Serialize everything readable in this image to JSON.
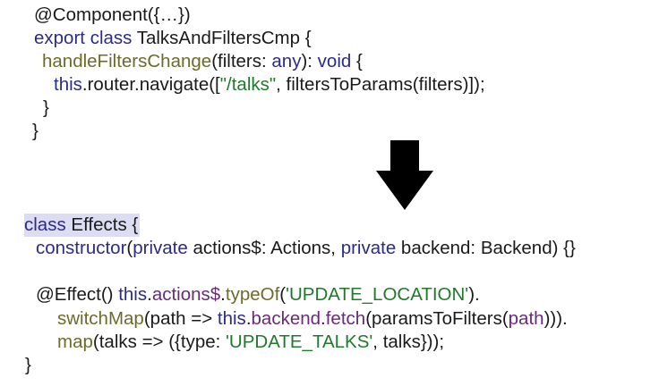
{
  "top_code": [
    [
      {
        "t": "@Component({…})",
        "c": "c-plain"
      }
    ],
    [
      {
        "t": "export",
        "c": "c-kw"
      },
      {
        "t": " ",
        "c": "c-plain"
      },
      {
        "t": "class",
        "c": "c-kw"
      },
      {
        "t": " TalksAndFiltersCmp {",
        "c": "c-plain"
      }
    ],
    [
      {
        "t": "handleFiltersChange",
        "c": "c-fn"
      },
      {
        "t": "(filters: ",
        "c": "c-plain"
      },
      {
        "t": "any",
        "c": "c-kw"
      },
      {
        "t": "): ",
        "c": "c-plain"
      },
      {
        "t": "void",
        "c": "c-kw"
      },
      {
        "t": " {",
        "c": "c-plain"
      }
    ],
    [
      {
        "t": "this",
        "c": "c-kw"
      },
      {
        "t": ".router.navigate([",
        "c": "c-plain"
      },
      {
        "t": "\"/talks\"",
        "c": "c-str"
      },
      {
        "t": ", filtersToParams(filters)]);",
        "c": "c-plain"
      }
    ],
    [
      {
        "t": "}",
        "c": "c-plain"
      }
    ],
    [
      {
        "t": "}",
        "c": "c-plain"
      }
    ]
  ],
  "bottom_code": [
    [
      {
        "t": "class",
        "c": "c-kw"
      },
      {
        "t": " Effects {",
        "c": "c-plain"
      }
    ],
    [
      {
        "t": "constructor",
        "c": "c-kw"
      },
      {
        "t": "(",
        "c": "c-plain"
      },
      {
        "t": "private",
        "c": "c-kw"
      },
      {
        "t": " actions$: Actions, ",
        "c": "c-plain"
      },
      {
        "t": "private",
        "c": "c-kw"
      },
      {
        "t": " backend: Backend) {}",
        "c": "c-plain"
      }
    ],
    [
      {
        "t": "",
        "c": "c-plain"
      }
    ],
    [
      {
        "t": "@Effect() ",
        "c": "c-plain"
      },
      {
        "t": "this",
        "c": "c-kw"
      },
      {
        "t": ".",
        "c": "c-plain"
      },
      {
        "t": "actions$",
        "c": "c-prop"
      },
      {
        "t": ".",
        "c": "c-plain"
      },
      {
        "t": "typeOf",
        "c": "c-fn"
      },
      {
        "t": "(",
        "c": "c-plain"
      },
      {
        "t": "'UPDATE_LOCATION'",
        "c": "c-str"
      },
      {
        "t": ").",
        "c": "c-plain"
      }
    ],
    [
      {
        "t": "switchMap",
        "c": "c-fn"
      },
      {
        "t": "(path => ",
        "c": "c-plain"
      },
      {
        "t": "this",
        "c": "c-kw"
      },
      {
        "t": ".",
        "c": "c-plain"
      },
      {
        "t": "backend",
        "c": "c-prop"
      },
      {
        "t": ".",
        "c": "c-plain"
      },
      {
        "t": "fetch",
        "c": "c-prop"
      },
      {
        "t": "(paramsToFilters(",
        "c": "c-plain"
      },
      {
        "t": "path",
        "c": "c-prop"
      },
      {
        "t": "))).",
        "c": "c-plain"
      }
    ],
    [
      {
        "t": "map",
        "c": "c-fn"
      },
      {
        "t": "(talks => ({type: ",
        "c": "c-plain"
      },
      {
        "t": "'UPDATE_TALKS'",
        "c": "c-str"
      },
      {
        "t": ", talks}));",
        "c": "c-plain"
      }
    ],
    [
      {
        "t": "}",
        "c": "c-plain"
      }
    ]
  ],
  "arrow_icon": "down-arrow-icon"
}
